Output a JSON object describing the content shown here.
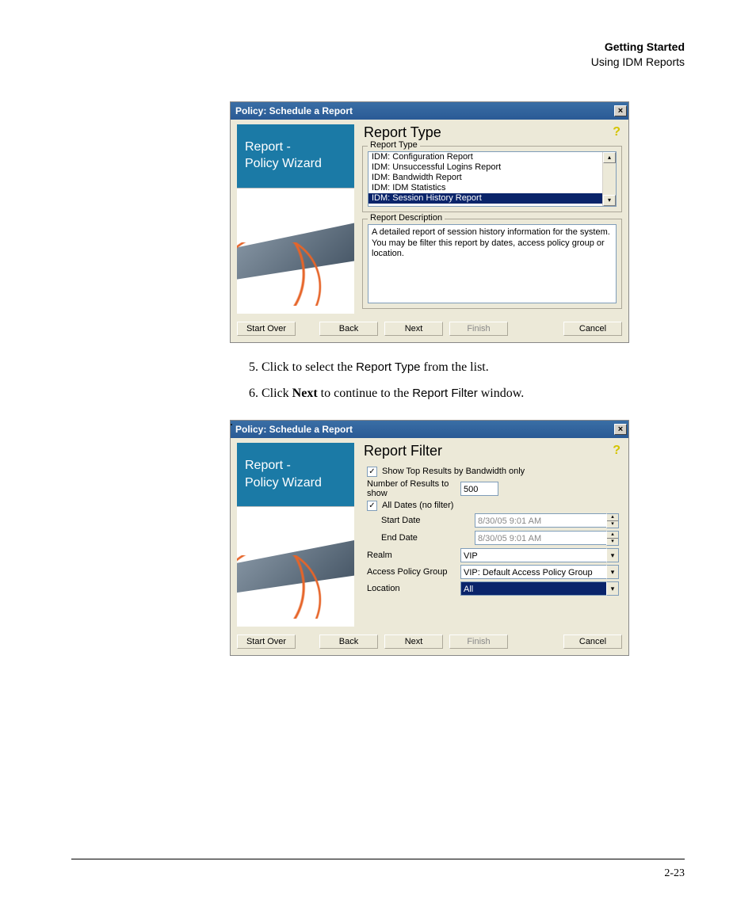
{
  "header": {
    "title": "Getting Started",
    "subtitle": "Using IDM Reports"
  },
  "buttons": {
    "start_over": "Start Over",
    "back": "Back",
    "next": "Next",
    "finish": "Finish",
    "cancel": "Cancel"
  },
  "dialog1": {
    "title": "Policy: Schedule a Report",
    "sidebar": {
      "line1": "Report -",
      "line2": "Policy Wizard"
    },
    "heading": "Report Type",
    "group_type_label": "Report Type",
    "report_types": [
      "IDM: Configuration Report",
      "IDM: Unsuccessful Logins Report",
      "IDM: Bandwidth Report",
      "IDM: IDM Statistics",
      "IDM: Session History Report"
    ],
    "selected_report_index": 4,
    "group_desc_label": "Report Description",
    "description": "A detailed report of session history information for the system. You may be filter this report by dates, access policy group or location."
  },
  "steps": {
    "s5": {
      "a": "Click to select the ",
      "b": "Report Type",
      "c": " from the list."
    },
    "s6": {
      "a": "Click ",
      "b": "Next",
      "c": " to continue to the ",
      "d": "Report Filter",
      "e": " window."
    },
    "dot": "."
  },
  "dialog2": {
    "title": "Policy: Schedule a Report",
    "sidebar": {
      "line1": "Report -",
      "line2": "Policy Wizard"
    },
    "heading": "Report Filter",
    "chk_top_results": "Show Top Results by Bandwidth only",
    "chk_top_results_checked": true,
    "lbl_num_results": "Number of Results to show",
    "val_num_results": "500",
    "chk_all_dates": "All Dates (no filter)",
    "chk_all_dates_checked": true,
    "lbl_start_date": "Start Date",
    "val_start_date": "8/30/05 9:01 AM",
    "lbl_end_date": "End Date",
    "val_end_date": "8/30/05 9:01 AM",
    "lbl_realm": "Realm",
    "val_realm": "VIP",
    "lbl_apg": "Access Policy Group",
    "val_apg": "VIP: Default Access Policy Group",
    "lbl_location": "Location",
    "val_location": "All"
  },
  "footer": {
    "page": "2-23"
  }
}
